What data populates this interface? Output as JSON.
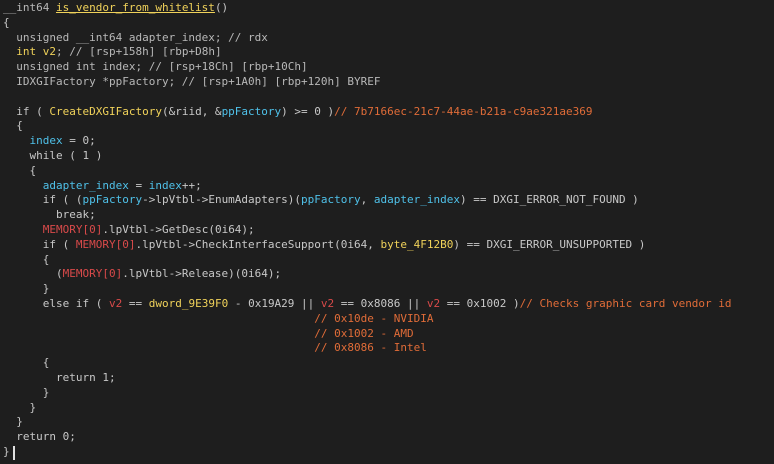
{
  "editor": {
    "lines": [
      [
        {
          "t": "__int64 ",
          "c": "type"
        },
        {
          "t": "is_vendor_from_whitelist",
          "c": "funcname"
        },
        {
          "t": "()",
          "c": "punct"
        }
      ],
      [
        {
          "t": "{",
          "c": "punct"
        }
      ],
      [
        {
          "t": "  unsigned __int64 adapter_index; // rdx",
          "c": "type"
        }
      ],
      [
        {
          "t": "  ",
          "c": "default"
        },
        {
          "t": "int v2",
          "c": "func"
        },
        {
          "t": "; // [rsp+158h] [rbp+D8h]",
          "c": "type"
        }
      ],
      [
        {
          "t": "  unsigned int index; // [rsp+18Ch] [rbp+10Ch]",
          "c": "type"
        }
      ],
      [
        {
          "t": "  IDXGIFactory *ppFactory; // [rsp+1A0h] [rbp+120h] BYREF",
          "c": "type"
        }
      ],
      [
        {
          "t": "",
          "c": "default"
        }
      ],
      [
        {
          "t": "  if ( ",
          "c": "default"
        },
        {
          "t": "CreateDXGIFactory",
          "c": "func"
        },
        {
          "t": "(&riid, &",
          "c": "default"
        },
        {
          "t": "ppFactory",
          "c": "var"
        },
        {
          "t": ") >= 0 )",
          "c": "default"
        },
        {
          "t": "// 7b7166ec-21c7-44ae-b21a-c9ae321ae369",
          "c": "comment"
        }
      ],
      [
        {
          "t": "  {",
          "c": "punct"
        }
      ],
      [
        {
          "t": "    ",
          "c": "default"
        },
        {
          "t": "index",
          "c": "var"
        },
        {
          "t": " = 0;",
          "c": "default"
        }
      ],
      [
        {
          "t": "    while ( 1 )",
          "c": "default"
        }
      ],
      [
        {
          "t": "    {",
          "c": "punct"
        }
      ],
      [
        {
          "t": "      ",
          "c": "default"
        },
        {
          "t": "adapter_index",
          "c": "var"
        },
        {
          "t": " = ",
          "c": "default"
        },
        {
          "t": "index",
          "c": "var"
        },
        {
          "t": "++;",
          "c": "default"
        }
      ],
      [
        {
          "t": "      if ( (",
          "c": "default"
        },
        {
          "t": "ppFactory",
          "c": "var"
        },
        {
          "t": "->lpVtbl->EnumAdapters)(",
          "c": "default"
        },
        {
          "t": "ppFactory",
          "c": "var"
        },
        {
          "t": ", ",
          "c": "default"
        },
        {
          "t": "adapter_index",
          "c": "var"
        },
        {
          "t": ") == DXGI_ERROR_NOT_FOUND )",
          "c": "default"
        }
      ],
      [
        {
          "t": "        break;",
          "c": "default"
        }
      ],
      [
        {
          "t": "      ",
          "c": "default"
        },
        {
          "t": "MEMORY[0]",
          "c": "global"
        },
        {
          "t": ".lpVtbl->GetDesc(0i64);",
          "c": "default"
        }
      ],
      [
        {
          "t": "      if ( ",
          "c": "default"
        },
        {
          "t": "MEMORY[0]",
          "c": "global"
        },
        {
          "t": ".lpVtbl->CheckInterfaceSupport(0i64, ",
          "c": "default"
        },
        {
          "t": "byte_4F12B0",
          "c": "func"
        },
        {
          "t": ") == DXGI_ERROR_UNSUPPORTED )",
          "c": "default"
        }
      ],
      [
        {
          "t": "      {",
          "c": "punct"
        }
      ],
      [
        {
          "t": "        (",
          "c": "default"
        },
        {
          "t": "MEMORY[0]",
          "c": "global"
        },
        {
          "t": ".lpVtbl->Release)(0i64);",
          "c": "default"
        }
      ],
      [
        {
          "t": "      }",
          "c": "punct"
        }
      ],
      [
        {
          "t": "      else if ( ",
          "c": "default"
        },
        {
          "t": "v2",
          "c": "global"
        },
        {
          "t": " == ",
          "c": "default"
        },
        {
          "t": "dword_9E39F0",
          "c": "func"
        },
        {
          "t": " - 0x19A29 || ",
          "c": "default"
        },
        {
          "t": "v2",
          "c": "global"
        },
        {
          "t": " == 0x8086 || ",
          "c": "default"
        },
        {
          "t": "v2",
          "c": "global"
        },
        {
          "t": " == 0x1002 )",
          "c": "default"
        },
        {
          "t": "// Checks graphic card vendor id",
          "c": "comment"
        }
      ],
      [
        {
          "t": "                                               // 0x10de - NVIDIA",
          "c": "comment"
        }
      ],
      [
        {
          "t": "                                               // 0x1002 - AMD",
          "c": "comment"
        }
      ],
      [
        {
          "t": "                                               // 0x8086 - Intel",
          "c": "comment"
        }
      ],
      [
        {
          "t": "      {",
          "c": "punct"
        }
      ],
      [
        {
          "t": "        return 1;",
          "c": "default"
        }
      ],
      [
        {
          "t": "      }",
          "c": "punct"
        }
      ],
      [
        {
          "t": "    }",
          "c": "punct"
        }
      ],
      [
        {
          "t": "  }",
          "c": "punct"
        }
      ],
      [
        {
          "t": "  return 0;",
          "c": "default"
        }
      ],
      [
        {
          "t": "}",
          "c": "punct"
        }
      ]
    ]
  }
}
